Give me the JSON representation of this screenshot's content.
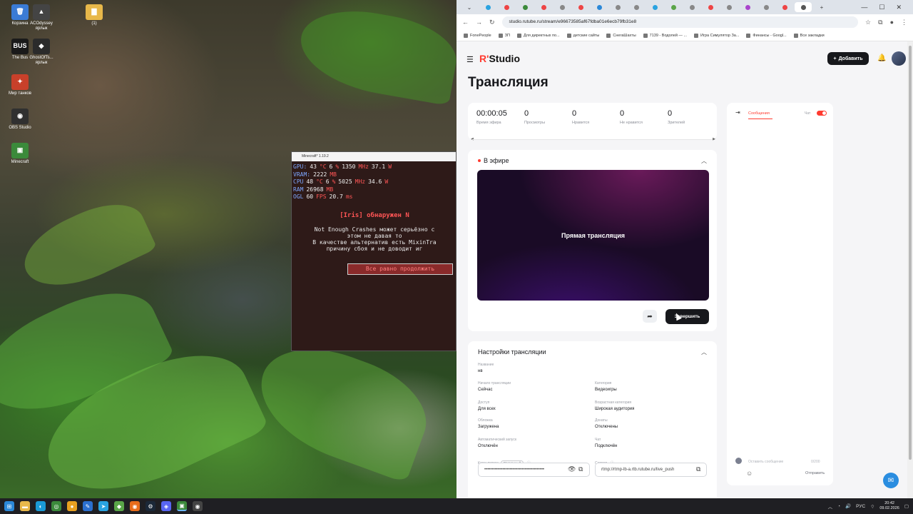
{
  "desktop": {
    "icons": [
      {
        "label": "Корзина",
        "color": "#3a7bd5",
        "glyph": "🗑"
      },
      {
        "label": "ACOdyssey ярлык",
        "color": "#444444",
        "glyph": "▲"
      },
      {
        "label": "(1)",
        "color": "#e8b84a",
        "glyph": "▇"
      },
      {
        "label": "The Bus",
        "color": "#1a1a1a",
        "glyph": "BUS"
      },
      {
        "label": "GhostOfTs... ярлык",
        "color": "#2b2b2b",
        "glyph": "◆"
      },
      {
        "label": "Мир танков",
        "color": "#c8402a",
        "glyph": "✦"
      },
      {
        "label": "OBS Studio",
        "color": "#303030",
        "glyph": "◉"
      },
      {
        "label": "Minecraft",
        "color": "#3b8a3b",
        "glyph": "▣"
      }
    ]
  },
  "minecraft": {
    "title": "Minecraft* 1.19.2",
    "stats": [
      {
        "k": "GPU:",
        "a": "43",
        "au": "°C",
        "b": "6",
        "bu": "%",
        "c": "1350",
        "cu": "MHz",
        "d": "37.1",
        "du": "W"
      },
      {
        "k": "VRAM:",
        "a": "2222",
        "au": "MB",
        "b": "",
        "bu": "",
        "c": "",
        "cu": "",
        "d": "",
        "du": ""
      },
      {
        "k": "CPU",
        "a": "48",
        "au": "°C",
        "b": "6",
        "bu": "%",
        "c": "5025",
        "cu": "MHz",
        "d": "34.6",
        "du": "W"
      },
      {
        "k": "RAM",
        "a": "26968",
        "au": "MB",
        "b": "",
        "bu": "",
        "c": "",
        "cu": "",
        "d": "",
        "du": ""
      },
      {
        "k": "OGL",
        "a": "60",
        "au": "FPS",
        "b": "20.7",
        "bu": "ms",
        "c": "",
        "cu": "",
        "d": "",
        "du": ""
      }
    ],
    "error_title": "[Iris] обнаружен N",
    "error_lines": [
      "Not Enough Crashes может серьёзно с",
      "этом не давая то",
      "В качестве альтернатив есть MixinTra",
      "причину сбоя и не доводит иг"
    ],
    "button": "Все равно продолжить"
  },
  "browser": {
    "tabs_count": 18,
    "url": "studio.rutube.ru/stream/e96673585af67fdba01e6ecb79fb31e8",
    "bookmarks": [
      "FonePeople",
      "ЗП",
      "Для директных по...",
      "детские сайты",
      "СнегаШахты",
      "7139 - Водолей — ...",
      "Игра Симулятор За...",
      "Финансы - Googl...",
      "Все закладки"
    ],
    "window_controls": [
      "—",
      "☐",
      "✕"
    ]
  },
  "studio": {
    "logo_prefix": "R'",
    "logo_name": "Studio",
    "add_button": "Добавить",
    "page_title": "Трансляция",
    "stats": [
      {
        "value": "00:00:05",
        "label": "Время эфира"
      },
      {
        "value": "0",
        "label": "Просмотры"
      },
      {
        "value": "0",
        "label": "Нравится"
      },
      {
        "value": "0",
        "label": "Не нравится"
      },
      {
        "value": "0",
        "label": "Зрителей"
      }
    ],
    "live_label": "В эфире",
    "player_text": "Прямая трансляция",
    "finish_button": "Завершить",
    "settings_title": "Настройки трансляции",
    "settings": {
      "name_label": "Название",
      "name_value": "нв",
      "start_label": "Начало трансляции",
      "start_value": "Сейчас",
      "category_label": "Категория",
      "category_value": "Видеоигры",
      "access_label": "Доступ",
      "access_value": "Для всех",
      "age_label": "Возрастная категория",
      "age_value": "Широкая аудитория",
      "cover_label": "Обложка",
      "cover_value": "Загружена",
      "donations_label": "Донаты",
      "donations_value": "Отключены",
      "autorec_label": "Автоматический запуск",
      "autorec_value": "Отключён",
      "chat_label": "Чат",
      "chat_value": "Подключён",
      "key_label": "Ключ потока",
      "key_badge": "Временный",
      "key_value": "••••••••••••••••••••••••••••••••••••••••",
      "server_label": "Сервер",
      "server_value": "rtmp://rtmp-lb-a.rtb.rutube.ru/live_push"
    },
    "chat": {
      "tab": "Сообщения",
      "chat_label": "Чат",
      "placeholder": "Оставить сообщение",
      "counter": "0/200",
      "send": "Отправить"
    }
  },
  "taskbar": {
    "apps": [
      {
        "glyph": "⊞",
        "color": "#2b88d8"
      },
      {
        "glyph": "▬",
        "color": "#e8b84a"
      },
      {
        "glyph": "◐",
        "color": "#1a9ad6"
      },
      {
        "glyph": "◎",
        "color": "#3b8a3b"
      },
      {
        "glyph": "●",
        "color": "#e8a020"
      },
      {
        "glyph": "✎",
        "color": "#2b6fcf"
      },
      {
        "glyph": "➤",
        "color": "#2aa3e0"
      },
      {
        "glyph": "◆",
        "color": "#5aa548"
      },
      {
        "glyph": "◉",
        "color": "#e86c1a"
      },
      {
        "glyph": "⚙",
        "color": "#1b2838"
      },
      {
        "glyph": "◈",
        "color": "#5865f2"
      },
      {
        "glyph": "▣",
        "color": "#3b8a3b"
      },
      {
        "glyph": "◉",
        "color": "#444444"
      }
    ],
    "lang": "РУС",
    "time": "20:42",
    "date": "09.02.2026"
  }
}
